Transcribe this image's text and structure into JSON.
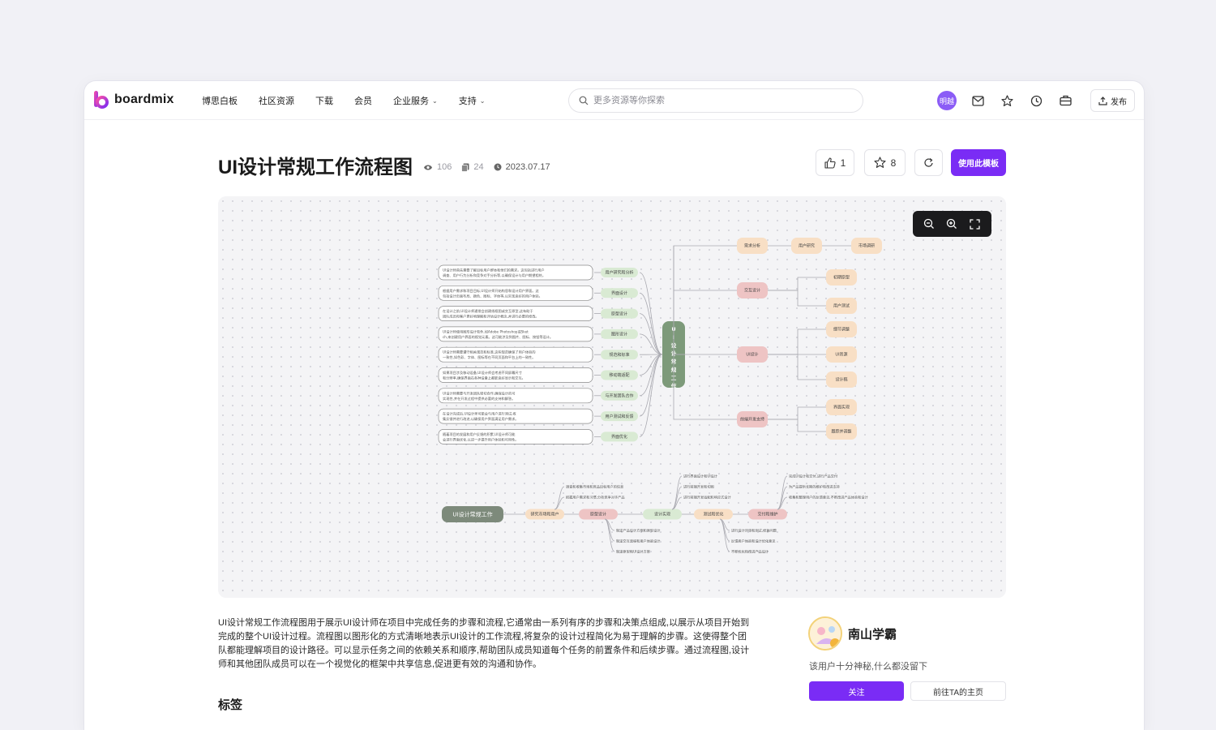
{
  "brand": {
    "name": "boardmix",
    "accent": "#7a2cf5"
  },
  "nav": {
    "items": [
      {
        "label": "博思白板",
        "has_dropdown": false
      },
      {
        "label": "社区资源",
        "has_dropdown": false
      },
      {
        "label": "下载",
        "has_dropdown": false
      },
      {
        "label": "会员",
        "has_dropdown": false
      },
      {
        "label": "企业服务",
        "has_dropdown": true
      },
      {
        "label": "支持",
        "has_dropdown": true
      }
    ],
    "search_placeholder": "更多资源等你探索",
    "avatar_text": "明越",
    "icons": [
      "mail-icon",
      "star-icon",
      "clock-icon",
      "briefcase-icon"
    ],
    "publish_label": "发布"
  },
  "template": {
    "title": "UI设计常规工作流程图",
    "views": "106",
    "copies": "24",
    "date": "2023.07.17",
    "likes": "1",
    "favorites": "8",
    "use_label": "使用此模板"
  },
  "mindmap": {
    "center": "UI设计常规工作",
    "left_branches": [
      {
        "label": "用户研究和分析",
        "text": "UI设计师首先需要了解目标用户群体和他们的需求。这包括进行用户调查、用户行为分析和竞争对手分析等,以确保设计与用户期望相符。"
      },
      {
        "label": "界面设计",
        "text": "根据用户需求和项目目标,UI设计师开始构思和设计用户界面。这包括设计页面布局、颜色、图标、字体等,以实现良好的用户体验。"
      },
      {
        "label": "原型设计",
        "text": "在设计之前,UI设计师通常会创建线框图或交互原型,这有助于团队成员和客户更好地理解和评估设计概念,并进行必要的修改。"
      },
      {
        "label": "图形设计",
        "text": "UI设计师使用图形设计软件,如Adobe Photoshop或Sketch,来创建用户界面的视觉元素。这可能涉及到图片、图标、按钮等设计。"
      },
      {
        "label": "规范和标准",
        "text": "UI设计师需要遵守相关规范和标准,这些规范确保了用户体验的一致性,如色彩、字体、图标等在不同页面和平台上的一致性。"
      },
      {
        "label": "移动端适配",
        "text": "如果项目涉及移动设备,UI设计师会考虑不同屏幕尺寸和分辨率,确保界面在各种设备上都能良好显示和交互。"
      },
      {
        "label": "与开发团队合作",
        "text": "UI设计师需要与开发团队密切合作,确保设计的可实现性,并在开发过程中提供必要的支持和解答。"
      },
      {
        "label": "用户测试和反馈",
        "text": "在设计完成后,UI设计师可能会与用户进行测试,收集反馈并进行改进,以确保用户界面满足用户需求。"
      },
      {
        "label": "界面优化",
        "text": "随着项目的发展和用户反馈的积累,UI设计师可能会进行界面优化,以进一步提升用户体验和可用性。"
      }
    ],
    "right_top": [
      {
        "label": "需求分析",
        "children": [
          "用户研究",
          "市场调研"
        ]
      },
      {
        "label": "交互设计",
        "children": [
          "初期原型",
          "用户测试"
        ]
      },
      {
        "label": "UI设计",
        "children": [
          "细节调整",
          "UI资源",
          "设计稿"
        ]
      },
      {
        "label": "前端开发支持",
        "children": [
          "界面实现",
          "跟踪并调整"
        ]
      }
    ],
    "flow": {
      "start": "UI设计常规工作",
      "steps": [
        "研究市场和用户",
        "原型设计",
        "设计实现",
        "测试和优化",
        "交付和维护"
      ],
      "notes_top": [
        [
          "调查和收集市场和竞品目标用户的信息",
          "把握用户需求和习惯,分析竞争对手产品"
        ],
        [
          "进行界面设计和UI设计",
          "进行前端开发和切图",
          "进行前端开发适配和响应式设计"
        ],
        [
          "完成UI设计和交付,进行产品交付",
          "为产品提供长期的维护和改进支持",
          "收集和整理用户的反馈意见,不断改进产品体验和设计"
        ]
      ],
      "notes_bottom": [
        [
          "制定产品设计方案和原型设计",
          "制定交互流程和用户体验设计",
          "制定原型和UI设计方案"
        ],
        [
          "进行设计评审和测试,修复问题",
          "反馈用户体验和设计优化意见",
          "不断优化和改进产品设计"
        ]
      ]
    }
  },
  "description": "UI设计常规工作流程图用于展示UI设计师在项目中完成任务的步骤和流程,它通常由一系列有序的步骤和决策点组成,以展示从项目开始到完成的整个UI设计过程。流程图以图形化的方式清晰地表示UI设计的工作流程,将复杂的设计过程简化为易于理解的步骤。这使得整个团队都能理解项目的设计路径。可以显示任务之间的依赖关系和顺序,帮助团队成员知道每个任务的前置条件和后续步骤。通过流程图,设计师和其他团队成员可以在一个视觉化的框架中共享信息,促进更有效的沟通和协作。",
  "tags_title": "标签",
  "author": {
    "name": "南山学霸",
    "bio": "该用户十分神秘,什么都没留下",
    "follow_label": "关注",
    "home_label": "前往TA的主页"
  },
  "colors": {
    "green_node": "#d9ead3",
    "green_center": "#7d9a7a",
    "peach_node": "#f8dfc5",
    "pink_node": "#eec4c4"
  }
}
